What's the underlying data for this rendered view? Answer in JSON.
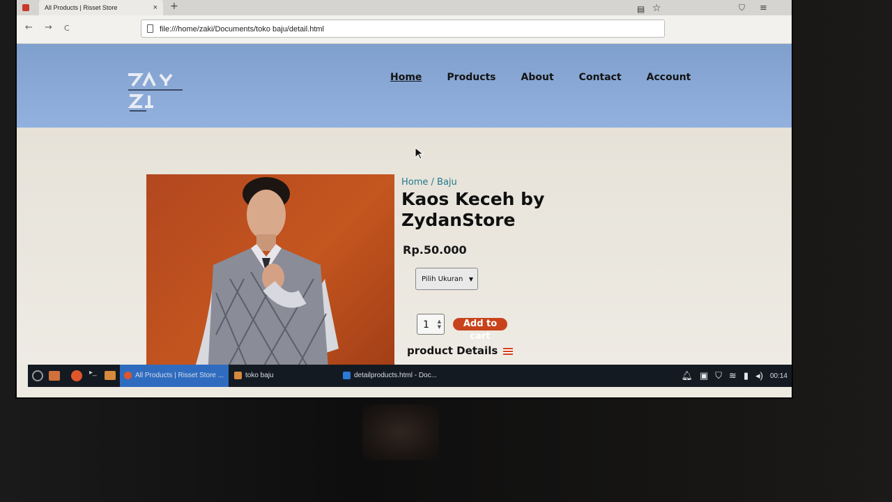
{
  "browser": {
    "tab_title": "All Products | Risset Store",
    "tab_close": "×",
    "new_tab": "+",
    "url": "file:///home/zaki/Documents/toko baju/detail.html",
    "back": "←",
    "forward": "→",
    "reload": "C"
  },
  "site": {
    "nav": [
      "Home",
      "Products",
      "About",
      "Contact",
      "Account"
    ],
    "active_nav": "Home"
  },
  "product": {
    "breadcrumb": "Home / Baju",
    "title": "Kaos Keceh by ZydanStore",
    "price": "Rp.50.000",
    "size_select": "Pilih Ukuran",
    "quantity": "1",
    "add_to_cart": "Add to cart",
    "details_heading": "product Details"
  },
  "taskbar": {
    "items": [
      {
        "label": "All Products | Risset Store ...",
        "active": true
      },
      {
        "label": "toko baju",
        "active": false
      },
      {
        "label": "detailproducts.html - Doc...",
        "active": false
      }
    ],
    "clock": "00:14"
  },
  "colors": {
    "header_bg": "#8aa9d7",
    "accent_button": "#c8431c",
    "breadcrumb_link": "#24788d",
    "taskbar_active": "#2f6cc0"
  }
}
